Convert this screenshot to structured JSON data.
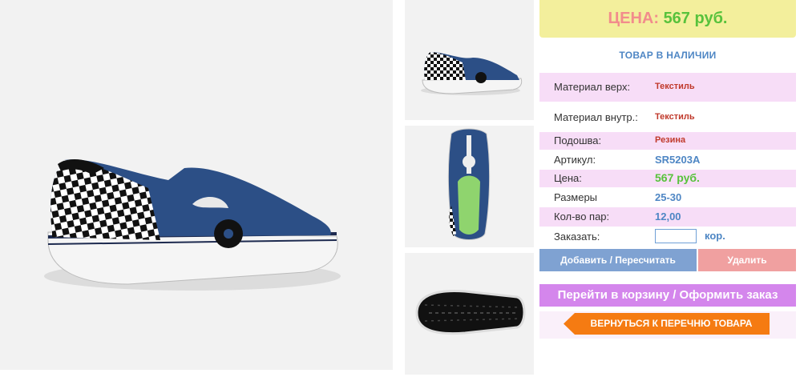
{
  "gallery": {
    "main_alt": "Текстиль",
    "thumbnails": [
      "side-view",
      "top-view",
      "sole-view"
    ]
  },
  "price": {
    "label": "ЦЕНА:",
    "value": "567 руб."
  },
  "stock_status": "ТОВАР В НАЛИЧИИ",
  "specs": [
    {
      "label": "Материал верх:",
      "value": "Текстиль"
    },
    {
      "label": "Материал внутр.:",
      "value": "Текстиль"
    },
    {
      "label": "Подошва:",
      "value": "Резина"
    },
    {
      "label": "Артикул:",
      "value": "SR5203A"
    },
    {
      "label": "Цена:",
      "value": "567 руб."
    },
    {
      "label": "Размеры",
      "value": "25-30"
    },
    {
      "label": "Кол-во пар:",
      "value": "12,00"
    }
  ],
  "order": {
    "label": "Заказать:",
    "value": "",
    "unit": "кор."
  },
  "buttons": {
    "add": "Добавить / Пересчитать",
    "delete": "Удалить",
    "cart": "Перейти в корзину / Оформить заказ",
    "back": "ВЕРНУТЬСЯ К ПЕРЕЧНЮ ТОВАРА"
  },
  "colors": {
    "price_bg": "#f3ef9c",
    "price_label": "#f28c8c",
    "price_value": "#58c23c",
    "row_pink": "#f7ddf7",
    "add_button": "#7fa2d2",
    "delete_button": "#f0a0a0",
    "cart_button": "#d486ec",
    "back_button": "#f57b12"
  }
}
